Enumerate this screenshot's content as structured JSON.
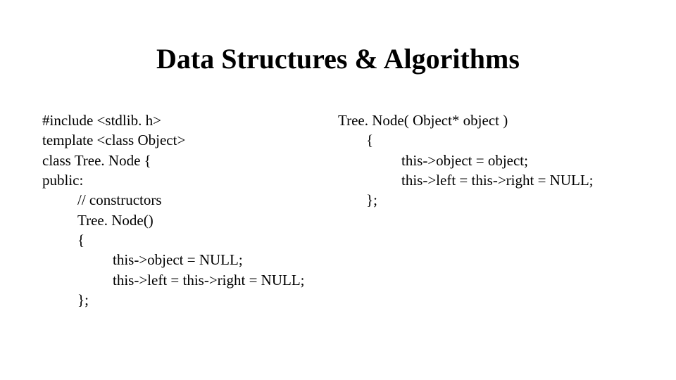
{
  "title": "Data Structures & Algorithms",
  "left": {
    "l0": "#include <stdlib. h>",
    "l1": "template <class Object>",
    "l2": "class Tree. Node {",
    "l3": "public:",
    "l4": "// constructors",
    "l5": "Tree. Node()",
    "l6": "{",
    "l7": "this->object = NULL;",
    "l8": "this->left = this->right = NULL;",
    "l9": "};"
  },
  "right": {
    "r0": "Tree. Node( Object* object )",
    "r1": "{",
    "r2": "this->object = object;",
    "r3": "this->left = this->right = NULL;",
    "r4": "};"
  }
}
